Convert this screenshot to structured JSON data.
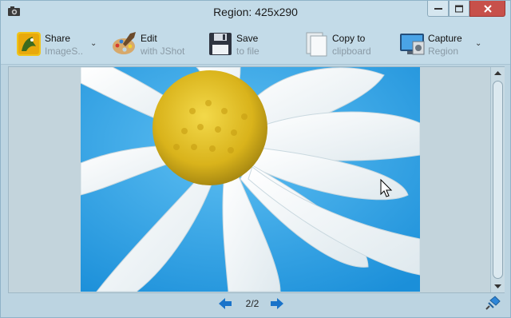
{
  "window": {
    "title": "Region: 425x290"
  },
  "toolbar": {
    "share": {
      "label": "Share",
      "sublabel": "ImageS.."
    },
    "edit": {
      "label": "Edit",
      "sublabel": "with JShot"
    },
    "save": {
      "label": "Save",
      "sublabel": "to file"
    },
    "copy": {
      "label": "Copy to",
      "sublabel": "clipboard"
    },
    "capture": {
      "label": "Capture",
      "sublabel": "Region"
    }
  },
  "preview": {
    "subject": "white daisy on blue background"
  },
  "status": {
    "page": "2/2"
  },
  "colors": {
    "accent": "#1a73c9",
    "sky": "#2a9be2",
    "close": "#c7504a"
  }
}
